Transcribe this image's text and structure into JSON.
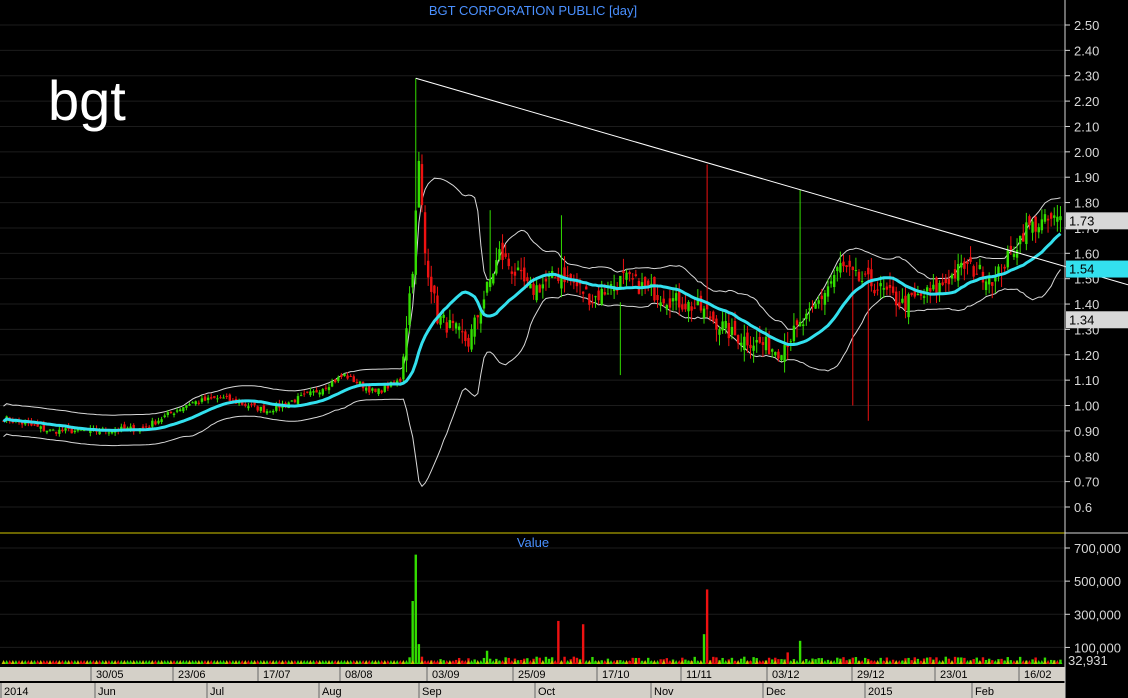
{
  "chart_data": {
    "type": "candlestick",
    "title": "BGT CORPORATION PUBLIC [day]",
    "symbol": "bgt",
    "price_axis": {
      "ticks": [
        "2.50",
        "2.40",
        "2.30",
        "2.20",
        "2.10",
        "2.00",
        "1.90",
        "1.80",
        "1.70",
        "1.60",
        "1.50",
        "1.40",
        "1.30",
        "1.20",
        "1.10",
        "1.00",
        "0.90",
        "0.80",
        "0.70",
        "0.6"
      ],
      "ylim": [
        0.55,
        2.58
      ]
    },
    "price_markers": [
      {
        "label": "1.73",
        "value": 1.73,
        "color": "#d8d8d8"
      },
      {
        "label": "1.54",
        "value": 1.54,
        "color": "#33e0ee"
      },
      {
        "label": "1.34",
        "value": 1.34,
        "color": "#d8d8d8"
      }
    ],
    "volume_panel": {
      "title": "Value",
      "ticks": [
        "700,000",
        "500,000",
        "300,000",
        "100,000"
      ],
      "ylim": [
        0,
        760000
      ],
      "last_value_label": "32,931"
    },
    "x_axis_top": [
      "30/05",
      "23/06",
      "17/07",
      "08/08",
      "03/09",
      "25/09",
      "17/10",
      "11/11",
      "03/12",
      "29/12",
      "23/01",
      "16/02"
    ],
    "x_axis_bottom": [
      "2014",
      "Jun",
      "Jul",
      "Aug",
      "Sep",
      "Oct",
      "Nov",
      "Dec",
      "2015",
      "Feb"
    ],
    "trendline": {
      "from": {
        "bar": 133,
        "price": 2.29
      },
      "to": {
        "bar": 277,
        "price": 1.78
      }
    },
    "colors": {
      "up": "#33dd00",
      "down": "#ee1111",
      "ma": "#33e0ee",
      "bands": "#d8d8d8",
      "trendline": "#ffffff",
      "separator": "#d4c800"
    },
    "anchors": [
      [
        0,
        0.95
      ],
      [
        15,
        0.9
      ],
      [
        30,
        0.9
      ],
      [
        45,
        0.91
      ],
      [
        60,
        1.01
      ],
      [
        70,
        1.03
      ],
      [
        85,
        0.98
      ],
      [
        100,
        1.05
      ],
      [
        110,
        1.12
      ],
      [
        120,
        1.05
      ],
      [
        128,
        1.1
      ],
      [
        132,
        1.55
      ],
      [
        134,
        1.95
      ],
      [
        136,
        1.6
      ],
      [
        140,
        1.35
      ],
      [
        150,
        1.25
      ],
      [
        160,
        1.6
      ],
      [
        170,
        1.45
      ],
      [
        180,
        1.52
      ],
      [
        190,
        1.42
      ],
      [
        200,
        1.5
      ],
      [
        215,
        1.42
      ],
      [
        225,
        1.38
      ],
      [
        235,
        1.28
      ],
      [
        250,
        1.22
      ],
      [
        260,
        1.35
      ],
      [
        270,
        1.55
      ],
      [
        275,
        1.5
      ],
      [
        280,
        1.48
      ],
      [
        290,
        1.4
      ],
      [
        300,
        1.45
      ],
      [
        310,
        1.55
      ],
      [
        320,
        1.5
      ],
      [
        330,
        1.7
      ],
      [
        338,
        1.73
      ]
    ],
    "spikes": [
      {
        "bar": 133,
        "high": 2.29
      },
      {
        "bar": 134,
        "high": 2.0
      },
      {
        "bar": 157,
        "high": 1.77
      },
      {
        "bar": 180,
        "high": 1.75
      },
      {
        "bar": 199,
        "high": 1.12
      },
      {
        "bar": 227,
        "high": 1.95
      },
      {
        "bar": 257,
        "high": 1.85
      }
    ],
    "volume_spikes": [
      {
        "bar": 133,
        "value": 660000
      },
      {
        "bar": 132,
        "value": 380000
      },
      {
        "bar": 134,
        "value": 120000
      },
      {
        "bar": 179,
        "value": 260000
      },
      {
        "bar": 187,
        "value": 240000
      },
      {
        "bar": 227,
        "value": 450000
      },
      {
        "bar": 226,
        "value": 180000
      },
      {
        "bar": 257,
        "value": 140000
      },
      {
        "bar": 156,
        "value": 80000
      },
      {
        "bar": 253,
        "value": 70000
      }
    ],
    "bar_count": 342
  }
}
